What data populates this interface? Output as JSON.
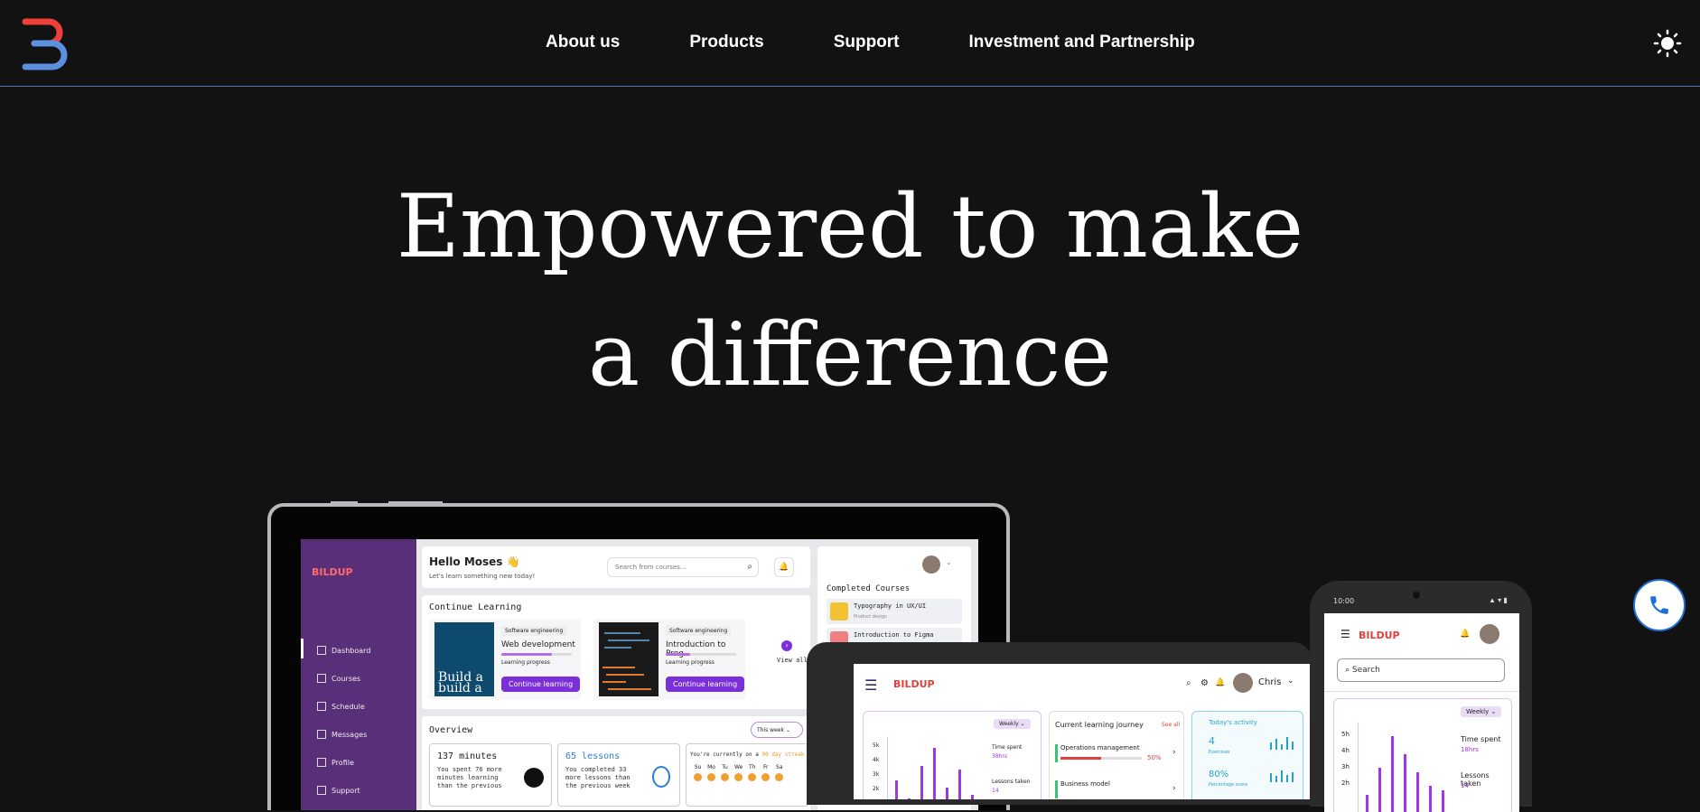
{
  "nav": {
    "links": [
      "About us",
      "Products",
      "Support",
      "Investment and Partnership"
    ],
    "logo_icon": "bildup-b-logo",
    "theme_icon": "sun-icon"
  },
  "hero": {
    "line1": "Empowered to make",
    "line2": "a difference"
  },
  "call_icon": "phone-icon",
  "colors": {
    "background": "#121212",
    "nav_border": "#4a78c8",
    "accent": "#7a2fd8",
    "logo_red": "#f0403c",
    "logo_blue": "#5b8fe0"
  },
  "laptop": {
    "brand": "BILDUP",
    "sidebar": [
      "Dashboard",
      "Courses",
      "Schedule",
      "Messages",
      "Profile",
      "Support"
    ],
    "greeting": "Hello Moses 👋",
    "subgreeting": "Let's learn something new today!",
    "search_placeholder": "Search from courses...",
    "continue_title": "Continue Learning",
    "courses": [
      {
        "category": "Software engineering",
        "name": "Web development",
        "progress_label": "Learning progress",
        "button": "Continue learning",
        "progress": 0.72,
        "thumb_text": "Build a build a"
      },
      {
        "category": "Software engineering",
        "name": "Introduction to Prog...",
        "progress_label": "Learning progress",
        "button": "Continue learning",
        "progress": 0.35
      }
    ],
    "view_all": "View all",
    "overview_title": "Overview",
    "overview_filter": "This week",
    "stat1_title": "137 minutes",
    "stat1_text": "You spent 76 more minutes learning than the previous",
    "stat2_title": "65 lessons",
    "stat2_text": "You completed 33 more lessons than the previous week",
    "streak_text": "You're currently on a",
    "streak_highlight": "90 day streak",
    "days": [
      "Su",
      "Mo",
      "Tu",
      "We",
      "Th",
      "Fr",
      "Sa"
    ],
    "completed_title": "Completed Courses",
    "completed": [
      {
        "name": "Typography in UX/UI",
        "tag": "Product design"
      },
      {
        "name": "Introduction to Figma",
        "tag": ""
      }
    ]
  },
  "tablet": {
    "brand": "BILDUP",
    "user": "Chris",
    "weekly": "Weekly",
    "y_ticks": [
      "5k",
      "4k",
      "3k",
      "2k"
    ],
    "time_spent_label": "Time spent",
    "time_spent_value": "38hrs",
    "lessons_label": "Lessons taken",
    "lessons_value": "14",
    "journey_title": "Current learning journey",
    "see_all": "See all",
    "journey_items": [
      {
        "name": "Operations management",
        "progress": 0.5,
        "percent": "50%"
      },
      {
        "name": "Business model",
        "progress": 0.2,
        "percent": ""
      }
    ],
    "activity_title": "Today's activity",
    "activity_value1": "4",
    "activity_label1": "Exercises",
    "activity_value2": "80%",
    "activity_label2": "Percentage score"
  },
  "phone": {
    "time": "10:00",
    "brand": "BILDUP",
    "search_placeholder": "Search",
    "weekly": "Weekly",
    "y_ticks": [
      "5h",
      "4h",
      "3h",
      "2h"
    ],
    "time_spent_label": "Time spent",
    "time_spent_value": "18hrs",
    "lessons_label": "Lessons taken",
    "lessons_value": "14"
  }
}
